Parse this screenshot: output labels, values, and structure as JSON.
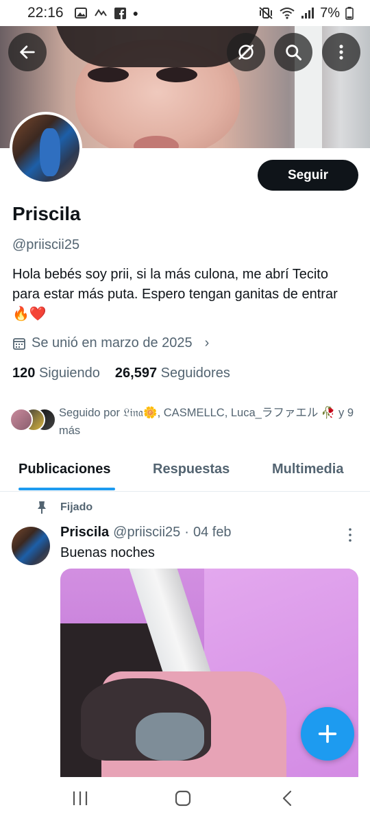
{
  "status_bar": {
    "time": "22:16",
    "left_icons": [
      "image-icon",
      "activity-icon",
      "facebook-icon",
      "dot-icon"
    ],
    "right_icons": [
      "mute-vibrate-icon",
      "wifi-icon",
      "signal-icon",
      "battery-icon"
    ],
    "battery": "7%"
  },
  "header": {
    "back_icon": "arrow-left-icon",
    "grok_icon": "grok-icon",
    "search_icon": "search-icon",
    "more_icon": "more-vertical-icon"
  },
  "profile": {
    "follow_label": "Seguir",
    "name": "Priscila",
    "handle": "@priiscii25",
    "bio": "Hola bebés soy prii, si la más culona, me abrí Tecito para estar más puta.  Espero tengan ganitas de entrar 🔥❤️",
    "joined": "Se unió en marzo de 2025",
    "following_count": "120",
    "following_label": "Siguiendo",
    "followers_count": "26,597",
    "followers_label": "Seguidores",
    "followed_by": "Seguido por 𝔏𝔦𝔫𝔞🌼, CASMELLC, Luca_ラファエル 🥀 y 9 más"
  },
  "tabs": [
    {
      "label": "Publicaciones",
      "active": true
    },
    {
      "label": "Respuestas",
      "active": false
    },
    {
      "label": "Multimedia",
      "active": false
    }
  ],
  "post": {
    "pinned_label": "Fijado",
    "author_name": "Priscila",
    "author_handle": "@priiscii25",
    "separator": "·",
    "date": "04 feb",
    "text": "Buenas noches"
  },
  "fab_icon": "plus-icon",
  "nav": [
    "recent-apps-icon",
    "home-icon",
    "back-icon"
  ],
  "colors": {
    "accent": "#1d9bf0",
    "text_primary": "#0f1419",
    "text_secondary": "#536471",
    "button_dark": "#0f1419"
  }
}
